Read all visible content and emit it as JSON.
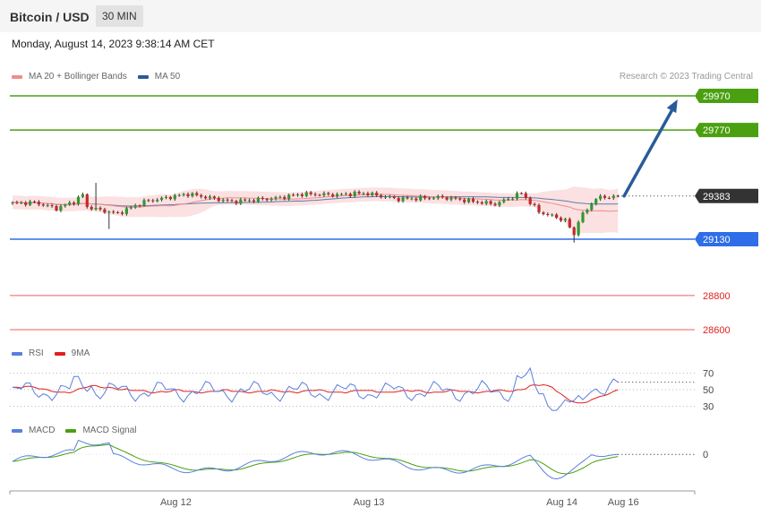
{
  "header": {
    "title": "Bitcoin / USD",
    "timeframe": "30 MIN"
  },
  "datetime": "Monday, August 14, 2023 9:38:14 AM CET",
  "legend_price": [
    {
      "label": "MA 20 + Bollinger Bands",
      "color": "#f08c8c"
    },
    {
      "label": "MA 50",
      "color": "#2a5b99"
    }
  ],
  "legend_rsi": [
    {
      "label": "RSI",
      "color": "#5a7fdd"
    },
    {
      "label": "9MA",
      "color": "#e02020"
    }
  ],
  "legend_macd": [
    {
      "label": "MACD",
      "color": "#5a7fdd"
    },
    {
      "label": "MACD Signal",
      "color": "#4aa010"
    }
  ],
  "copyright": "Research © 2023 Trading Central",
  "colors": {
    "green_level": "#4aa010",
    "blue_level": "#2f6ee8",
    "red_level": "#e02020",
    "current_price_tag": "#333333",
    "arrow": "#2a5b99",
    "candle_up": "#2e9a2e",
    "candle_down": "#c62828"
  },
  "chart_data": [
    {
      "type": "candlestick",
      "title": "Bitcoin / USD",
      "ylim": [
        28500,
        30120
      ],
      "levels": [
        {
          "value": 29970,
          "label": "29970",
          "kind": "resistance",
          "color": "#4aa010"
        },
        {
          "value": 29770,
          "label": "29770",
          "kind": "resistance",
          "color": "#4aa010"
        },
        {
          "value": 29130,
          "label": "29130",
          "kind": "pivot",
          "color": "#2f6ee8"
        },
        {
          "value": 28800,
          "label": "28800",
          "kind": "support",
          "color": "#e02020"
        },
        {
          "value": 28600,
          "label": "28600",
          "kind": "support",
          "color": "#e02020"
        }
      ],
      "current_price": {
        "value": 29383,
        "label": "29383"
      },
      "x_labels": [
        {
          "index": 36,
          "label": "Aug 12"
        },
        {
          "index": 80,
          "label": "Aug 13"
        },
        {
          "index": 124,
          "label": "Aug 14"
        },
        {
          "index": 138,
          "label": "Aug 16"
        }
      ],
      "candles": [],
      "ma20": [],
      "ma50": [],
      "bollinger_upper": [],
      "bollinger_lower": [],
      "forecast_arrow": {
        "from_index": 139,
        "from_value": 29383,
        "to_index": 152,
        "to_value": 29970
      }
    },
    {
      "type": "line",
      "title": "RSI",
      "ylim": [
        18,
        82
      ],
      "reference_lines": [
        70,
        50,
        30
      ],
      "tick_labels": [
        "70",
        "50",
        "30"
      ],
      "series": [
        {
          "name": "RSI",
          "values": []
        },
        {
          "name": "9MA",
          "values": []
        }
      ]
    },
    {
      "type": "line",
      "title": "MACD",
      "ylim": [
        -45,
        14
      ],
      "reference_lines": [
        0
      ],
      "tick_labels": [
        "0"
      ],
      "series": [
        {
          "name": "MACD",
          "values": []
        },
        {
          "name": "MACD Signal",
          "values": []
        }
      ]
    }
  ]
}
